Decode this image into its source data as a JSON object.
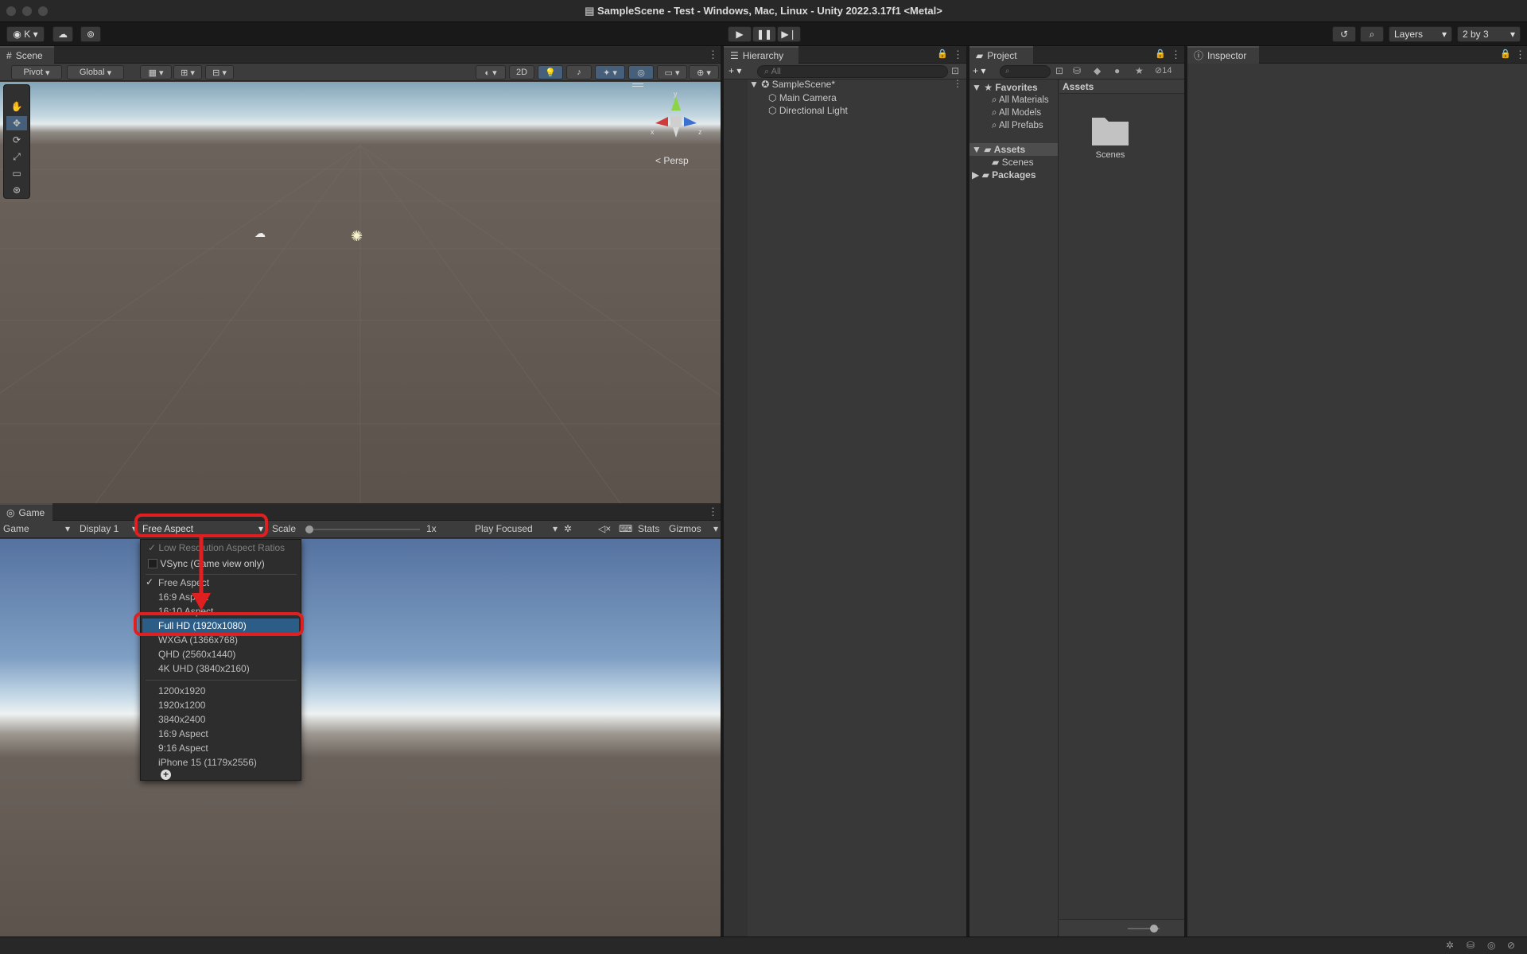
{
  "window": {
    "title": "SampleScene - Test - Windows, Mac, Linux - Unity 2022.3.17f1 <Metal>"
  },
  "toolbar": {
    "account": "K",
    "layers": "Layers",
    "layout": "2 by 3"
  },
  "scene": {
    "tab": "Scene",
    "pivot": "Pivot",
    "global": "Global",
    "mode2d": "2D",
    "persp": "Persp",
    "gizmo_axes": {
      "x": "x",
      "y": "y",
      "z": "z"
    }
  },
  "game": {
    "tab": "Game",
    "view_select": "Game",
    "display": "Display 1",
    "aspect": "Free Aspect",
    "scale_label": "Scale",
    "scale_value": "1x",
    "play_mode": "Play Focused",
    "stats": "Stats",
    "gizmos": "Gizmos"
  },
  "aspect_menu": {
    "low_res": "Low Resolution Aspect Ratios",
    "vsync": "VSync (Game view only)",
    "items": [
      "Free Aspect",
      "16:9 Aspect",
      "16:10 Aspect",
      "Full HD (1920x1080)",
      "WXGA (1366x768)",
      "QHD (2560x1440)",
      "4K UHD (3840x2160)"
    ],
    "custom": [
      "1200x1920",
      "1920x1200",
      "3840x2400",
      "16:9 Aspect",
      "9:16 Aspect",
      "iPhone 15 (1179x2556)"
    ],
    "selected_index": 0,
    "highlighted_index": 3
  },
  "hierarchy": {
    "tab": "Hierarchy",
    "search_placeholder": "All",
    "scene": "SampleScene*",
    "children": [
      "Main Camera",
      "Directional Light"
    ]
  },
  "project": {
    "tab": "Project",
    "hidden_count": "14",
    "favorites": "Favorites",
    "fav_items": [
      "All Materials",
      "All Models",
      "All Prefabs"
    ],
    "assets": "Assets",
    "scenes": "Scenes",
    "packages": "Packages",
    "grid_header": "Assets",
    "grid_items": [
      "Scenes"
    ]
  },
  "inspector": {
    "tab": "Inspector"
  },
  "colors": {
    "accent": "#2c5d87",
    "highlight": "#e02020"
  }
}
